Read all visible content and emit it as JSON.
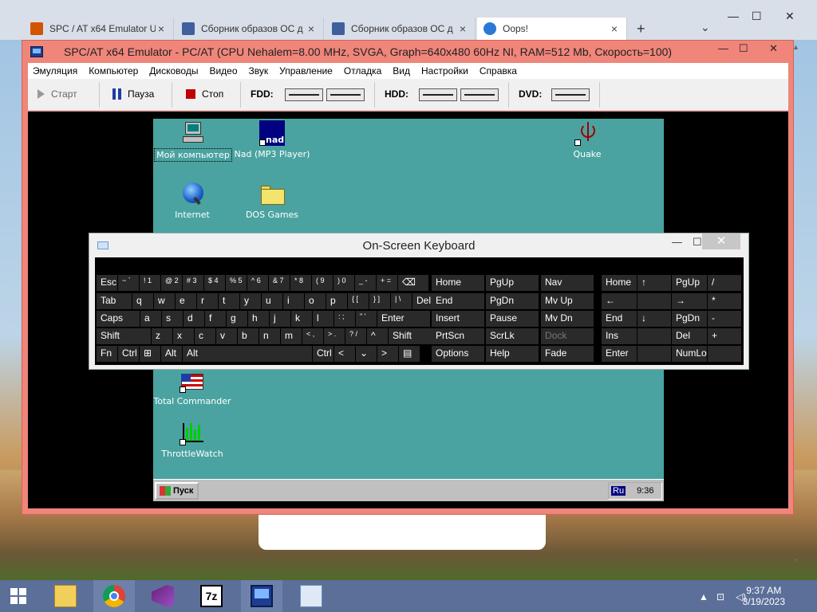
{
  "browser": {
    "tabs": [
      {
        "label": "SPC / AT x64 Emulator U",
        "close": "×",
        "color": "#d35400"
      },
      {
        "label": "Сборник образов ОС д",
        "close": "×",
        "color": "#3f5f9f"
      },
      {
        "label": "Сборник образов ОС д",
        "close": "×",
        "color": "#3f5f9f"
      },
      {
        "label": "Oops!",
        "close": "×",
        "color": "#2b78d6"
      }
    ],
    "new_tab": "+",
    "tab_dropdown": "⌄",
    "window_controls": {
      "minimize": "—",
      "maximize": "☐",
      "close": "✕"
    },
    "scroll_up": "▲",
    "scroll_down": "▼"
  },
  "emulator": {
    "title": "SPC/AT x64 Emulator - PC/AT (CPU Nehalem=8.00 MHz, SVGA, Graph=640x480 60Hz NI, RAM=512 Mb, Скорость=100)",
    "window_controls": {
      "minimize": "—",
      "maximize": "☐",
      "close": "✕"
    },
    "menu": [
      "Эмуляция",
      "Компьютер",
      "Дисководы",
      "Видео",
      "Звук",
      "Управление",
      "Отладка",
      "Вид",
      "Настройки",
      "Справка"
    ],
    "toolbar": {
      "start": "Старт",
      "pause": "Пауза",
      "stop": "Стоп",
      "fdd": "FDD:",
      "hdd": "HDD:",
      "dvd": "DVD:"
    },
    "colors": {
      "frame": "#f0857a",
      "stop": "#c00000",
      "pause": "#1f3ca6"
    }
  },
  "win95": {
    "icons": [
      {
        "label": "Мой компьютер",
        "icon": "my-computer-icon"
      },
      {
        "label": "Nad (MP3 Player)",
        "icon": "nad-icon",
        "badge": "nad"
      },
      {
        "label": "Quake",
        "icon": "quake-icon"
      },
      {
        "label": "Internet",
        "icon": "internet-icon"
      },
      {
        "label": "DOS Games",
        "icon": "folder-icon"
      },
      {
        "label": "Total Commander",
        "icon": "total-commander-icon"
      },
      {
        "label": "ThrottleWatch",
        "icon": "throttlewatch-icon"
      }
    ],
    "start": "Пуск",
    "lang": "Ru",
    "clock": "9:36",
    "desktop_color": "#4aa3a0"
  },
  "osk": {
    "title": "On-Screen Keyboard",
    "controls": {
      "minimize": "—",
      "maximize": "☐",
      "close": "✕"
    },
    "rows": [
      [
        "Esc",
        "~ `",
        "! 1",
        "@ 2",
        "# 3",
        "$ 4",
        "% 5",
        "^ 6",
        "& 7",
        "* 8",
        "( 9",
        ") 0",
        "_ -",
        "+ =",
        "⌫"
      ],
      [
        "Tab",
        "q",
        "w",
        "e",
        "r",
        "t",
        "y",
        "u",
        "i",
        "o",
        "p",
        "{ [",
        "} ]",
        "| \\",
        "Del"
      ],
      [
        "Caps",
        "a",
        "s",
        "d",
        "f",
        "g",
        "h",
        "j",
        "k",
        "l",
        ": ;",
        "\" '",
        "Enter"
      ],
      [
        "Shift",
        "z",
        "x",
        "c",
        "v",
        "b",
        "n",
        "m",
        "< ,",
        "> .",
        "? /",
        "^",
        "Shift"
      ],
      [
        "Fn",
        "Ctrl",
        "⊞",
        "Alt",
        "Alt",
        "Ctrl",
        "<",
        "⌄",
        ">",
        "▤"
      ]
    ],
    "nav": [
      [
        "Home",
        "PgUp",
        "Nav"
      ],
      [
        "End",
        "PgDn",
        "Mv Up"
      ],
      [
        "Insert",
        "Pause",
        "Mv Dn"
      ],
      [
        "PrtScn",
        "ScrLk",
        "Dock"
      ],
      [
        "Options",
        "Help",
        "Fade"
      ]
    ],
    "numpad": [
      [
        "Home",
        "↑",
        "PgUp",
        "/"
      ],
      [
        "←",
        "",
        "→",
        "*"
      ],
      [
        "End",
        "↓",
        "PgDn",
        "-"
      ],
      [
        "Ins",
        "",
        "Del",
        "+"
      ],
      [
        "Enter",
        "",
        "NumLock",
        ""
      ]
    ]
  },
  "taskbar": {
    "apps": [
      "file-explorer-icon",
      "chrome-icon",
      "visual-studio-icon",
      "7zip-icon",
      "emulator-icon",
      "keyboard-icon"
    ],
    "sevenzip_label": "7z",
    "time": "9:37 AM",
    "date": "3/19/2023",
    "tray": {
      "up": "▲",
      "network": "⊡",
      "volume": "◁)"
    }
  }
}
